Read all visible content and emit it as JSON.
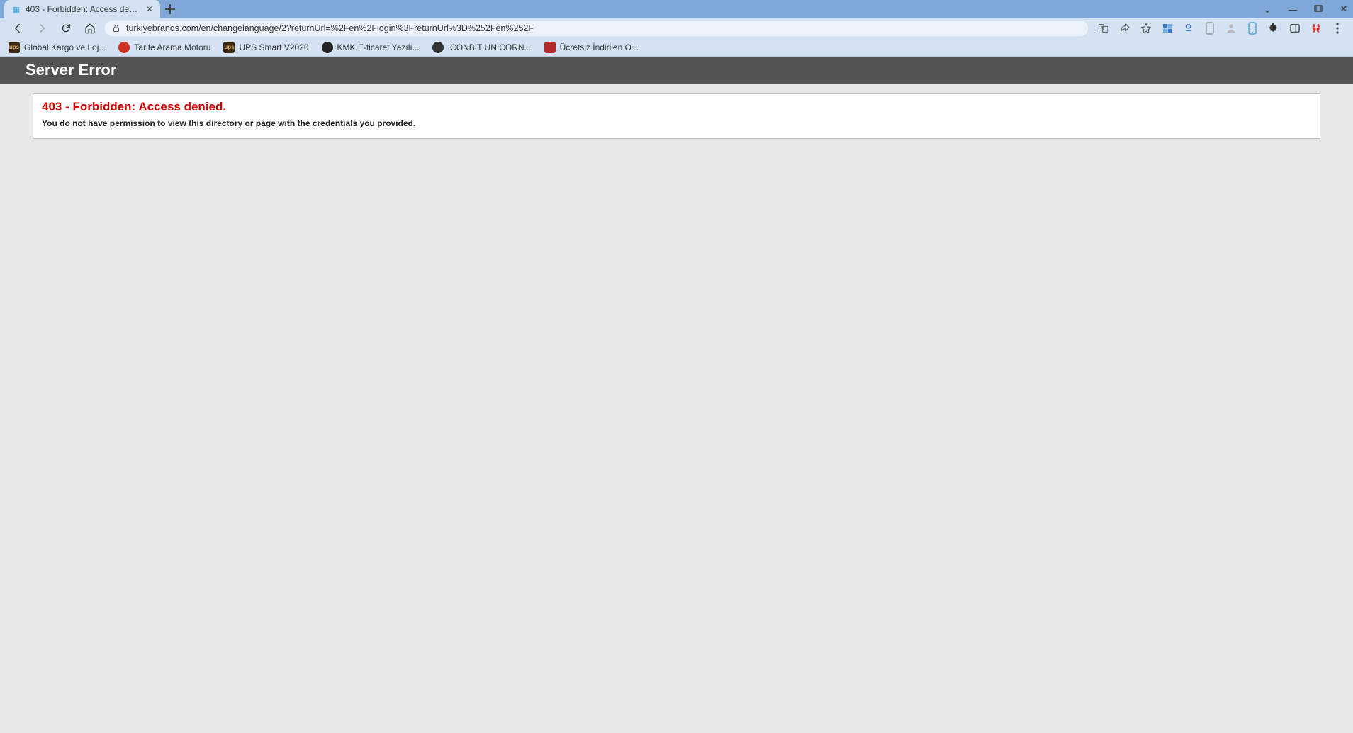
{
  "tab": {
    "title": "403 - Forbidden: Access denied."
  },
  "url": "turkiyebrands.com/en/changelanguage/2?returnUrl=%2Fen%2Flogin%3FreturnUrl%3D%252Fen%252F",
  "bookmarks": [
    {
      "label": "Global Kargo ve Loj..."
    },
    {
      "label": "Tarife Arama Motoru"
    },
    {
      "label": "UPS Smart V2020"
    },
    {
      "label": "KMK E-ticaret Yazılı..."
    },
    {
      "label": "ICONBIT UNICORN..."
    },
    {
      "label": "Ücretsiz İndirilen O..."
    }
  ],
  "page": {
    "serverHeader": "Server Error",
    "errorTitle": "403 - Forbidden: Access denied.",
    "errorMessage": "You do not have permission to view this directory or page with the credentials you provided."
  }
}
